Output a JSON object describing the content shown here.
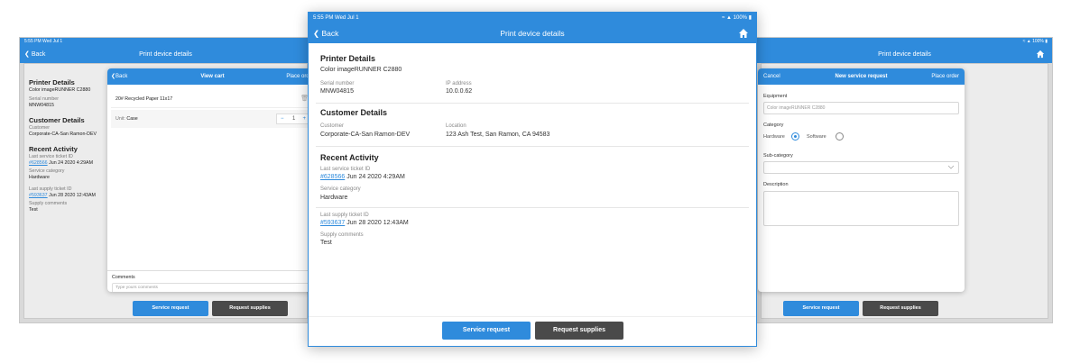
{
  "status": {
    "time": "5:55 PM  Wed Jul 1",
    "battery": "100%"
  },
  "nav": {
    "back": "Back",
    "title": "Print device details"
  },
  "printer": {
    "heading": "Printer Details",
    "model": "Color imageRUNNER C2880",
    "serial_label": "Serial number",
    "serial": "MNW04815",
    "ip_label": "IP address",
    "ip": "10.0.0.62"
  },
  "customer": {
    "heading": "Customer Details",
    "customer_label": "Customer",
    "customer": "Corporate-CA-San Ramon-DEV",
    "location_label": "Location",
    "location": "123 Ash Test, San Ramon, CA 94583"
  },
  "activity": {
    "heading": "Recent Activity",
    "service_ticket_label": "Last service ticket ID",
    "service_ticket_id": "#628566",
    "service_ticket_date": "Jun 24 2020 4:29AM",
    "service_category_label": "Service category",
    "service_category": "Hardware",
    "supply_ticket_label": "Last supply ticket ID",
    "supply_ticket_id": "#593637",
    "supply_ticket_date": "Jun 28 2020 12:43AM",
    "supply_comments_label": "Supply comments",
    "supply_comments": "Test"
  },
  "buttons": {
    "service_request": "Service request",
    "request_supplies": "Request supplies"
  },
  "cart": {
    "back": "Back",
    "title": "View cart",
    "action": "Place order",
    "item_name": "20# Recycled Paper 11x17",
    "unit_label": "Unit:",
    "unit": "Case",
    "qty_minus": "−",
    "qty": "1",
    "qty_plus": "+",
    "comments_label": "Comments",
    "comments_placeholder": "Type yours comments"
  },
  "request": {
    "cancel": "Cancel",
    "title": "New service request",
    "action": "Place order",
    "equipment_label": "Equipment",
    "equipment_value": "Color imageRUNNER C2880",
    "category_label": "Category",
    "hardware": "Hardware",
    "software": "Software",
    "selected_category": "Hardware",
    "subcategory_label": "Sub-category",
    "description_label": "Description"
  }
}
